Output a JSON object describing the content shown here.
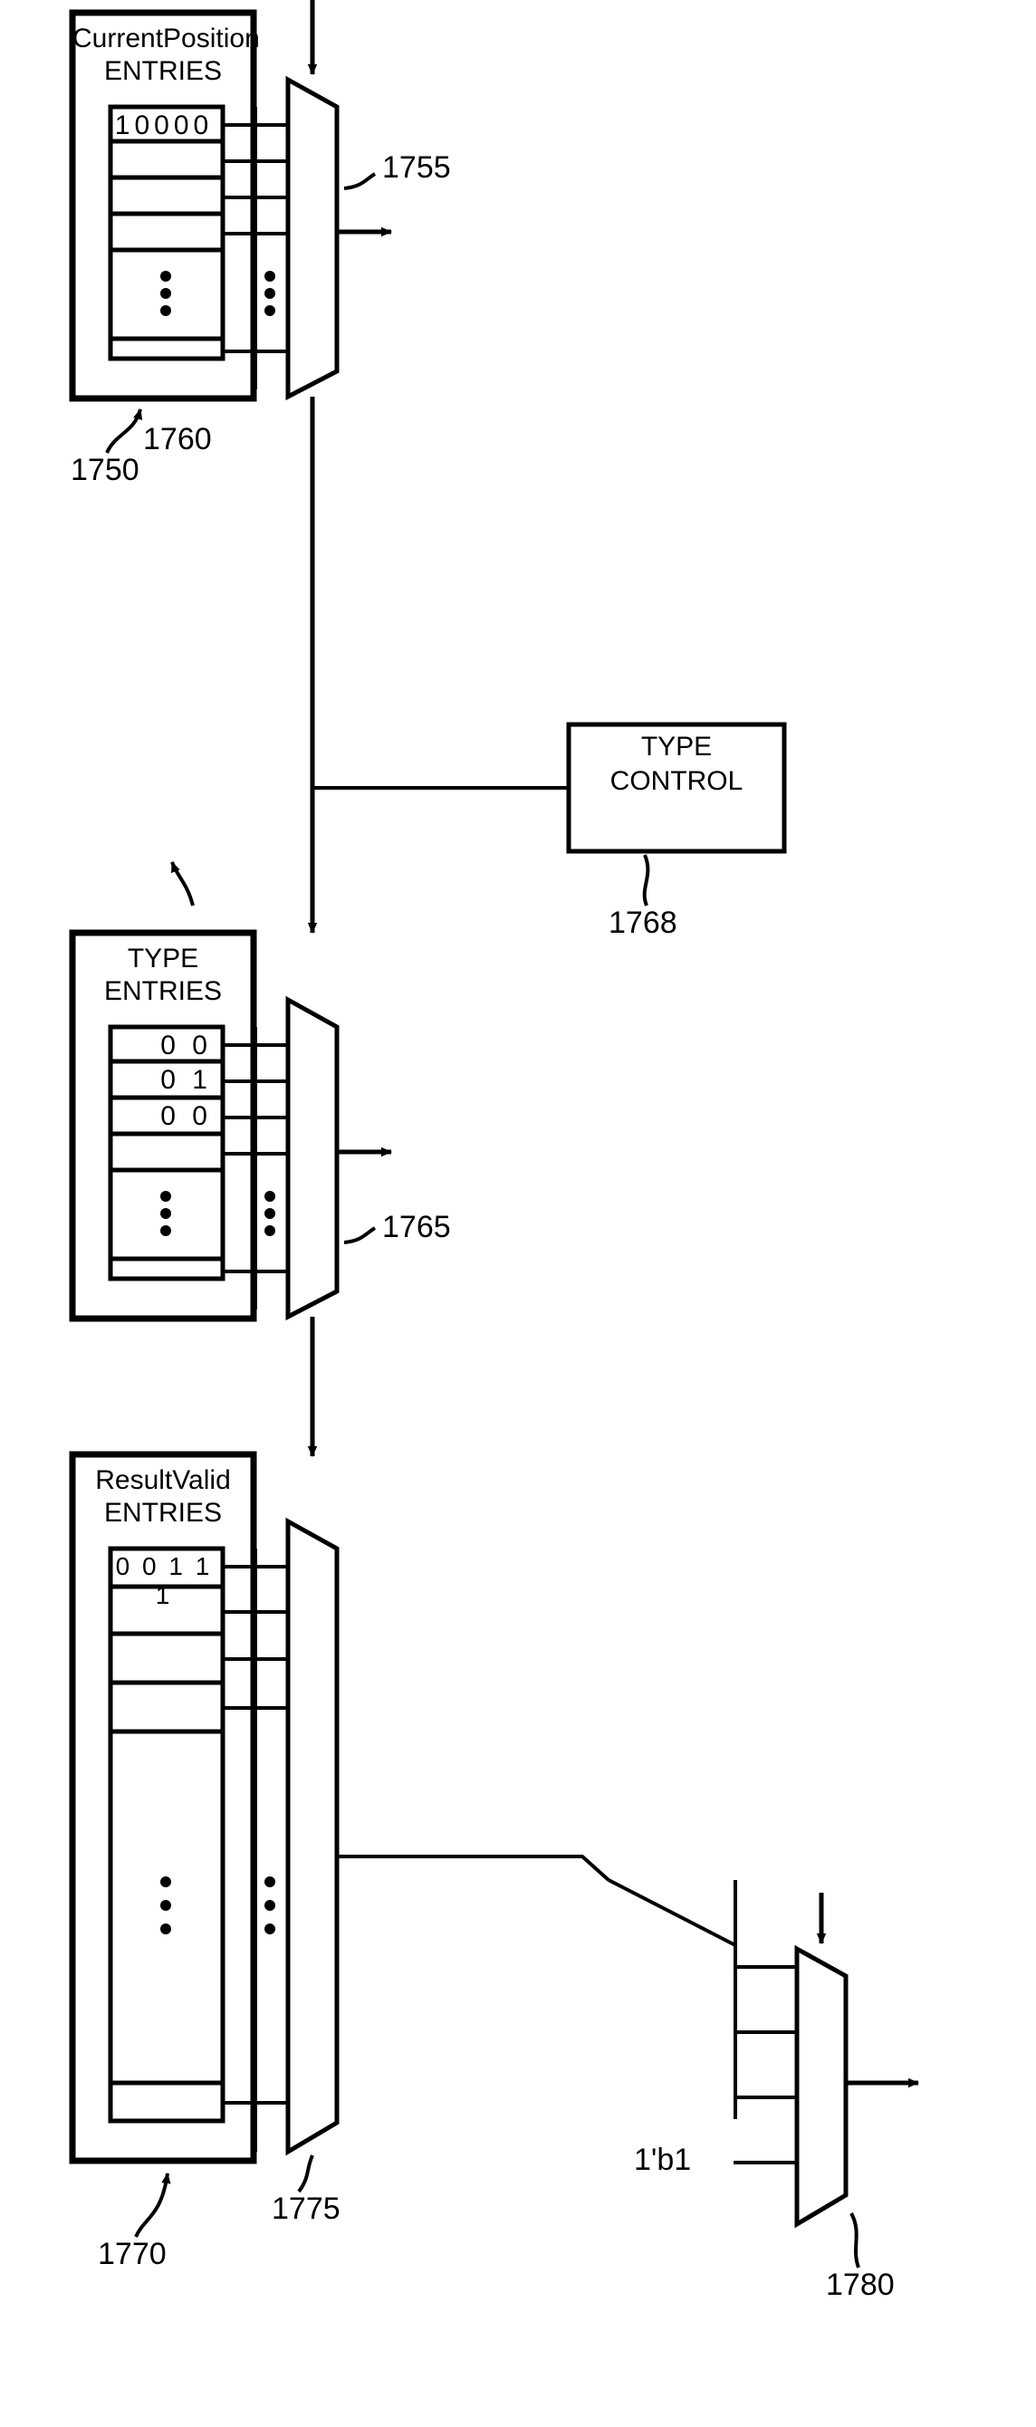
{
  "figure": {
    "kind": "patent-block-diagram",
    "background": "#ffffff",
    "ink": "#000000"
  },
  "blocks": [
    {
      "id": "current-position",
      "title_line1": "CurrentPosition",
      "title_line2": "ENTRIES",
      "ref": "1750",
      "entries": [
        "10000",
        "",
        "",
        "",
        "",
        ""
      ],
      "ellipsis": "vertical-dots"
    },
    {
      "id": "type",
      "title_line1": "TYPE",
      "title_line2": "ENTRIES",
      "ref": "1760",
      "entries": [
        "0 0",
        "0 1",
        "0 0",
        "",
        "",
        ""
      ],
      "ellipsis": "vertical-dots"
    },
    {
      "id": "result-valid",
      "title_line1": "ResultValid",
      "title_line2": "ENTRIES",
      "ref": "1770",
      "entries": [
        "0 0 1 1 1",
        "",
        "",
        "",
        "",
        ""
      ],
      "ellipsis": "vertical-dots"
    }
  ],
  "muxes": [
    {
      "id": "mux-1755",
      "ref": "1755"
    },
    {
      "id": "mux-1765",
      "ref": "1765"
    },
    {
      "id": "mux-1775",
      "ref": "1775"
    },
    {
      "id": "mux-1780",
      "ref": "1780",
      "const_input_label": "1'b1"
    }
  ],
  "control": {
    "id": "type-control",
    "line1": "TYPE",
    "line2": "CONTROL",
    "ref": "1768"
  },
  "reference_numerals": [
    "1750",
    "1755",
    "1760",
    "1765",
    "1768",
    "1770",
    "1775",
    "1780"
  ],
  "constants": {
    "one_bit_one": "1'b1"
  }
}
